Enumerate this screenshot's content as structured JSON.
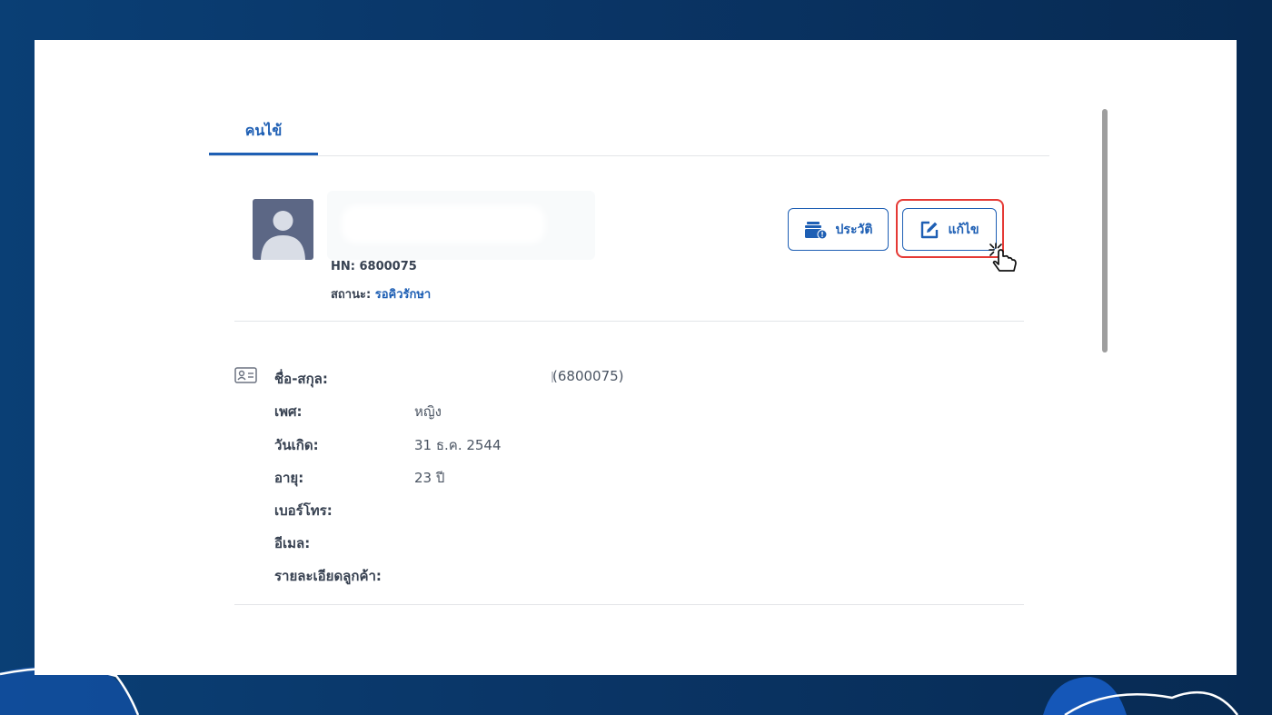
{
  "tabs": [
    {
      "label": "คนไข้"
    }
  ],
  "patient": {
    "hn_text": "HN: 6800075",
    "status_label": "สถานะ:",
    "status_value": "รอคิวรักษา"
  },
  "actions": {
    "history_label": "ประวัติ",
    "edit_label": "แก้ไข"
  },
  "info": {
    "fields": [
      {
        "label": "ชื่อ-สกุล:",
        "value": "(6800075)"
      },
      {
        "label": "เพศ:",
        "value": "หญิง"
      },
      {
        "label": "วันเกิด:",
        "value": "31 ธ.ค. 2544"
      },
      {
        "label": "อายุ:",
        "value": "23 ปี"
      },
      {
        "label": "เบอร์โทร:",
        "value": ""
      },
      {
        "label": "อีเมล:",
        "value": ""
      },
      {
        "label": "รายละเอียดลูกค้า:",
        "value": ""
      }
    ]
  },
  "colors": {
    "accent": "#1e5fb4",
    "highlight": "#e53935",
    "background": "#0a3566",
    "avatar": "#5c6785"
  },
  "icons": [
    "user-avatar-icon",
    "history-icon",
    "edit-icon",
    "id-card-icon",
    "pointer-cursor-icon"
  ]
}
